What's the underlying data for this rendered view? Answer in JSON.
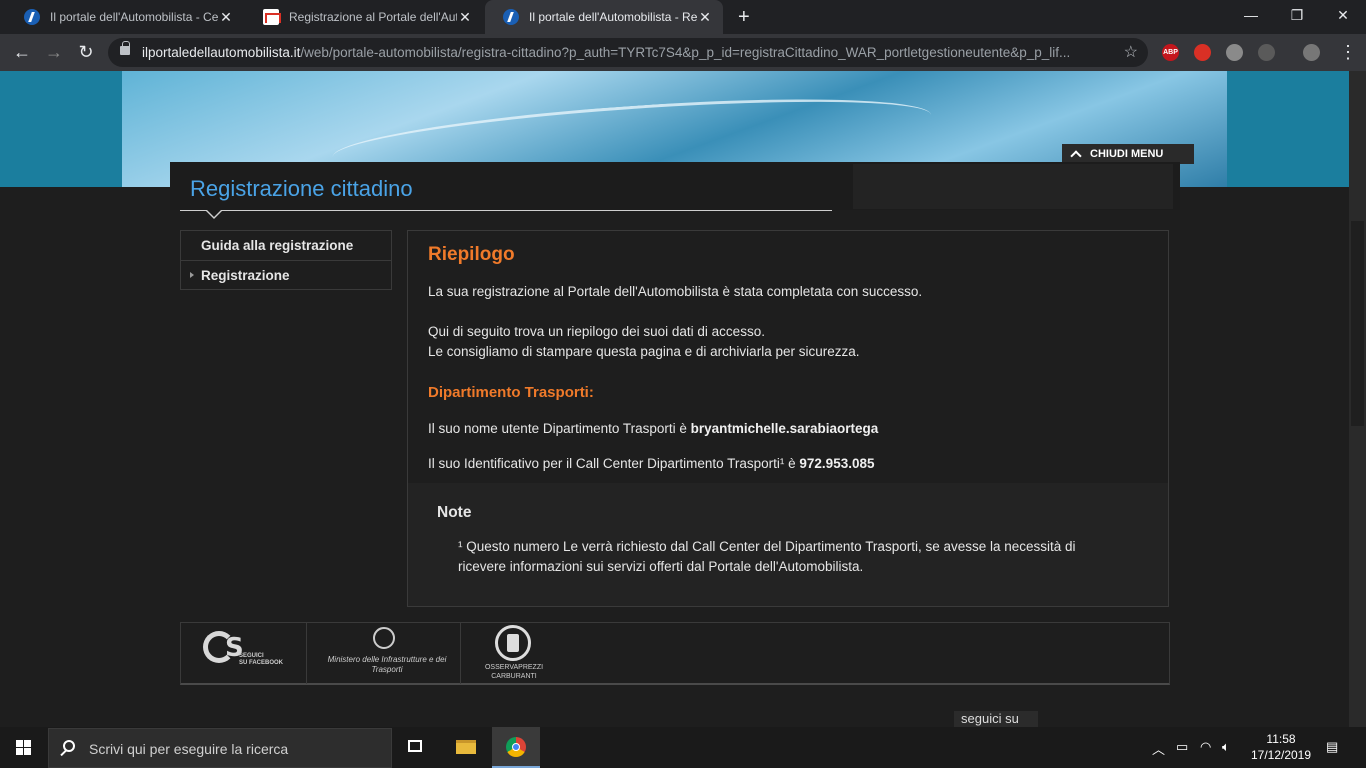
{
  "browser": {
    "tabs": [
      {
        "title": "Il portale dell'Automobilista - Cer",
        "active": false,
        "icon": "portale-icon"
      },
      {
        "title": "Registrazione al Portale dell'Auto",
        "active": false,
        "icon": "gmail-icon"
      },
      {
        "title": "Il portale dell'Automobilista - Reg",
        "active": true,
        "icon": "portale-icon"
      }
    ],
    "url_host": "ilportaledellautomobilista.it",
    "url_path": "/web/portale-automobilista/registra-cittadino?p_auth=TYRTc7S4&p_p_id=registraCittadino_WAR_portletgestioneutente&p_p_lif...",
    "extensions": [
      "ABP",
      "stop-icon",
      "compass-icon",
      "glasses-icon",
      "profile-icon"
    ]
  },
  "page": {
    "menu_close_label": "CHIUDI MENU",
    "title": "Registrazione cittadino",
    "sidenav": [
      {
        "label": "Guida alla registrazione"
      },
      {
        "label": "Registrazione"
      }
    ],
    "summary": {
      "heading": "Riepilogo",
      "line1": "La sua registrazione al Portale dell'Automobilista è stata completata con successo.",
      "line2": "Qui di seguito trova un riepilogo dei suoi dati di accesso.",
      "line3": "Le consigliamo di stampare questa pagina e di archiviarla per sicurezza.",
      "dept_heading": "Dipartimento Trasporti:",
      "username_prefix": "Il suo nome utente Dipartimento Trasporti è ",
      "username": "bryantmichelle.sarabiaortega",
      "callcenter_prefix": "Il suo Identificativo per il Call Center Dipartimento Trasporti¹ è ",
      "callcenter_id": "972.953.085"
    },
    "note": {
      "title": "Note",
      "text": "¹ Questo numero Le verrà richiesto dal Call Center del Dipartimento Trasporti, se avesse la necessità di ricevere informazioni sui servizi offerti dal Portale dell'Automobilista."
    },
    "footer_logos": {
      "cs_caption": "SEGUICI\nSU FACEBOOK",
      "ministry_caption": "Ministero delle Infrastrutture e dei Trasporti",
      "oss_caption": "OSSERVAPREZZI\nCARBURANTI"
    },
    "seguici": "seguici su"
  },
  "taskbar": {
    "search_placeholder": "Scrivi qui per eseguire la ricerca",
    "time": "11:58",
    "date": "17/12/2019"
  }
}
